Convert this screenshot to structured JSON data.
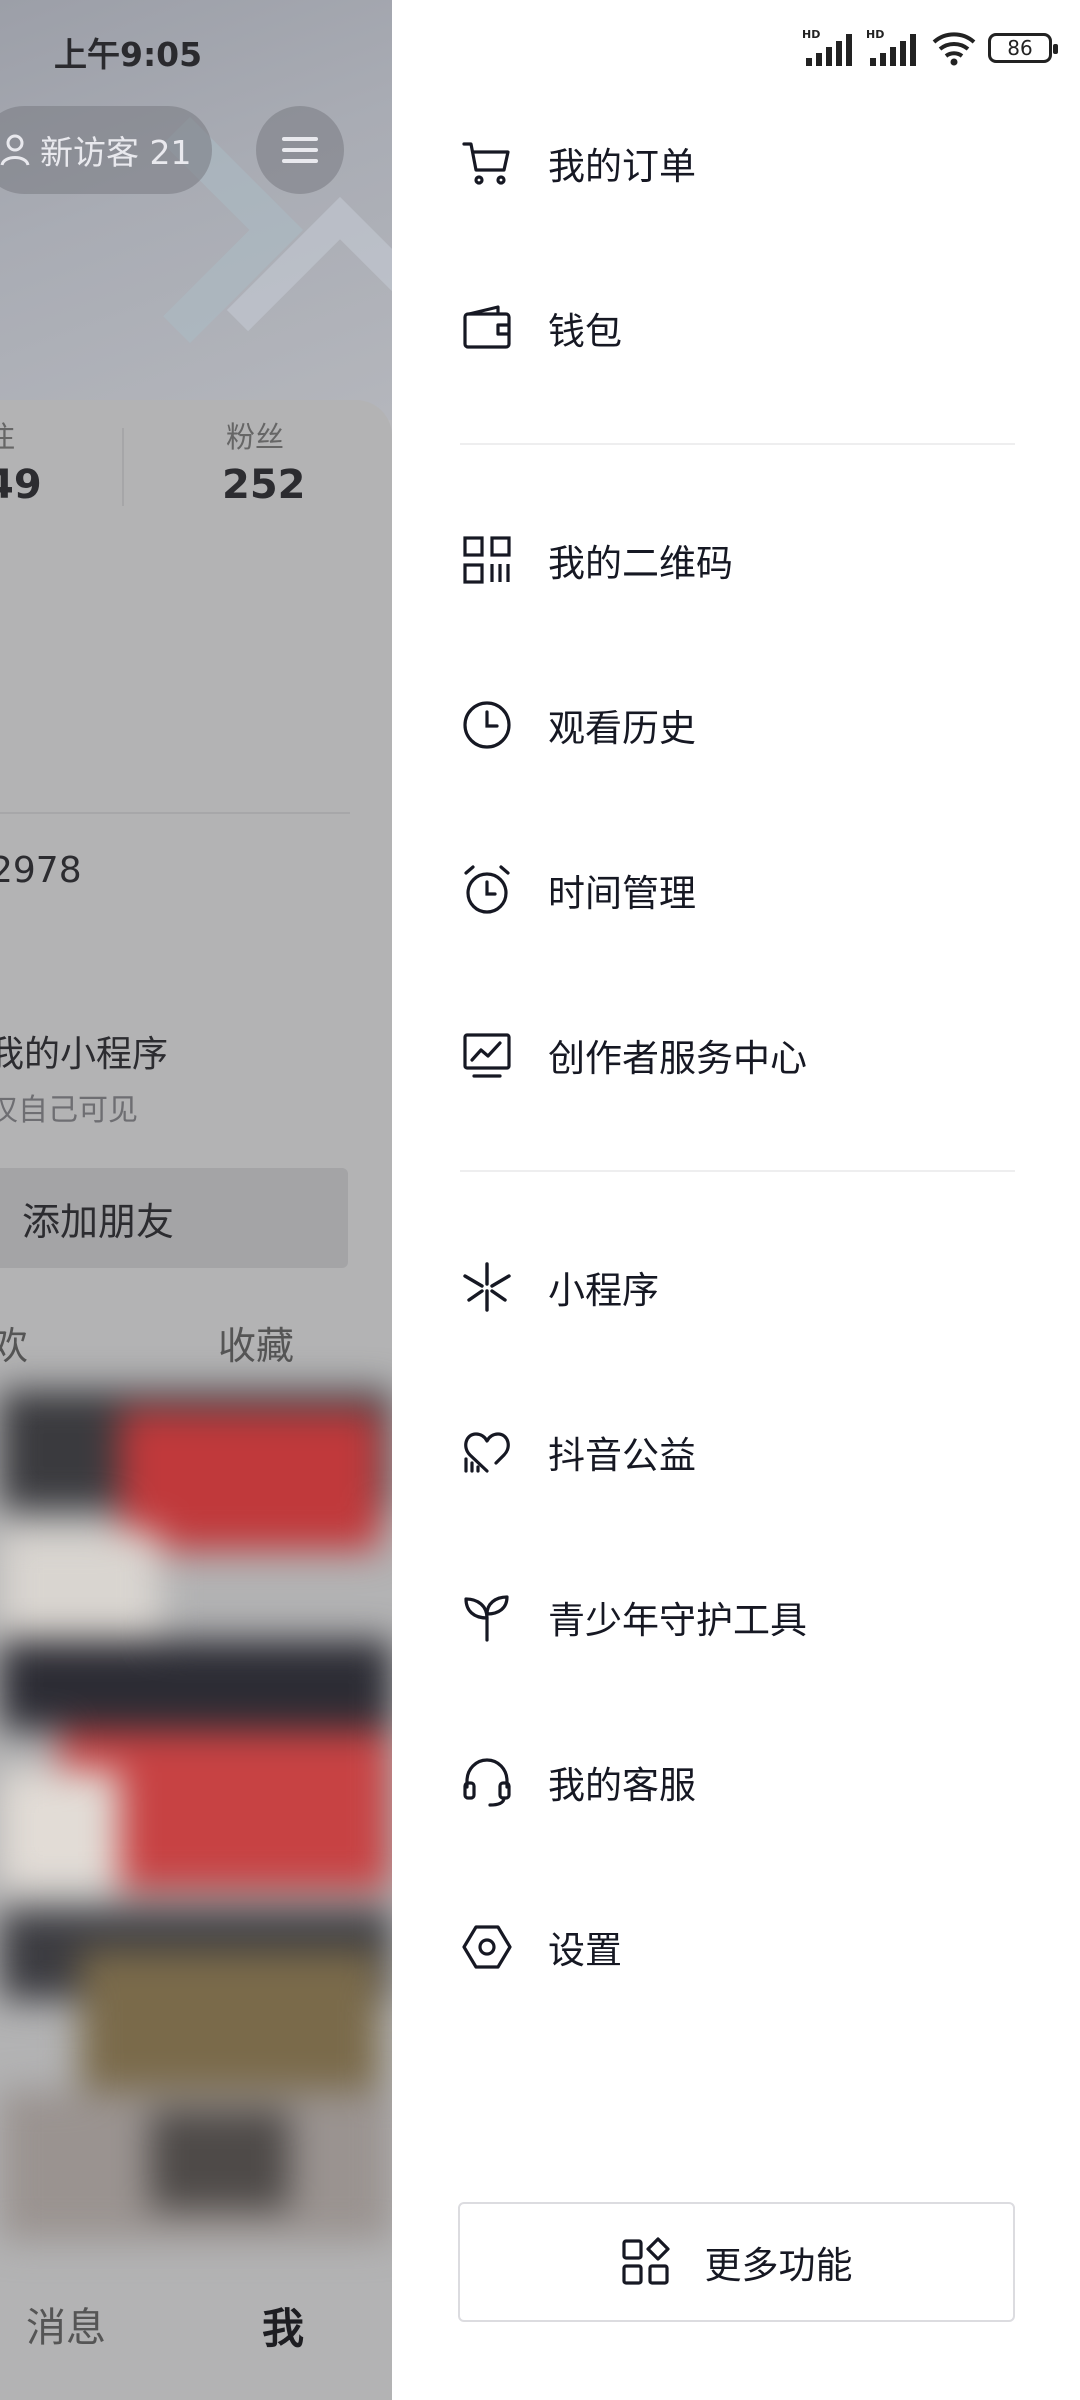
{
  "status_bar": {
    "time": "上午9:05",
    "battery": "86",
    "signal1": "HD",
    "signal2": "HD"
  },
  "background": {
    "visitor_pill": "新访客 21",
    "stats": {
      "following_label_partial": "注",
      "following_value_partial": "49",
      "fans_label": "粉丝",
      "fans_value": "252"
    },
    "id_partial": "2978",
    "mini_program_title": "我的小程序",
    "mini_program_sub": "仅自己可见",
    "add_friend": "添加朋友",
    "tab_partial": "欢",
    "tab_favorites": "收藏",
    "bottom_nav": {
      "messages": "消息",
      "me": "我"
    }
  },
  "drawer": {
    "group1": [
      {
        "label": "我的订单",
        "icon": "cart-icon"
      },
      {
        "label": "钱包",
        "icon": "wallet-icon"
      }
    ],
    "group2": [
      {
        "label": "我的二维码",
        "icon": "qr-code-icon"
      },
      {
        "label": "观看历史",
        "icon": "clock-icon"
      },
      {
        "label": "时间管理",
        "icon": "alarm-icon"
      },
      {
        "label": "创作者服务中心",
        "icon": "chart-monitor-icon"
      }
    ],
    "group3": [
      {
        "label": "小程序",
        "icon": "mini-program-icon"
      },
      {
        "label": "抖音公益",
        "icon": "charity-heart-icon"
      },
      {
        "label": "青少年守护工具",
        "icon": "sprout-icon"
      },
      {
        "label": "我的客服",
        "icon": "headset-icon"
      },
      {
        "label": "设置",
        "icon": "settings-hexagon-icon"
      }
    ],
    "more_button": "更多功能"
  }
}
